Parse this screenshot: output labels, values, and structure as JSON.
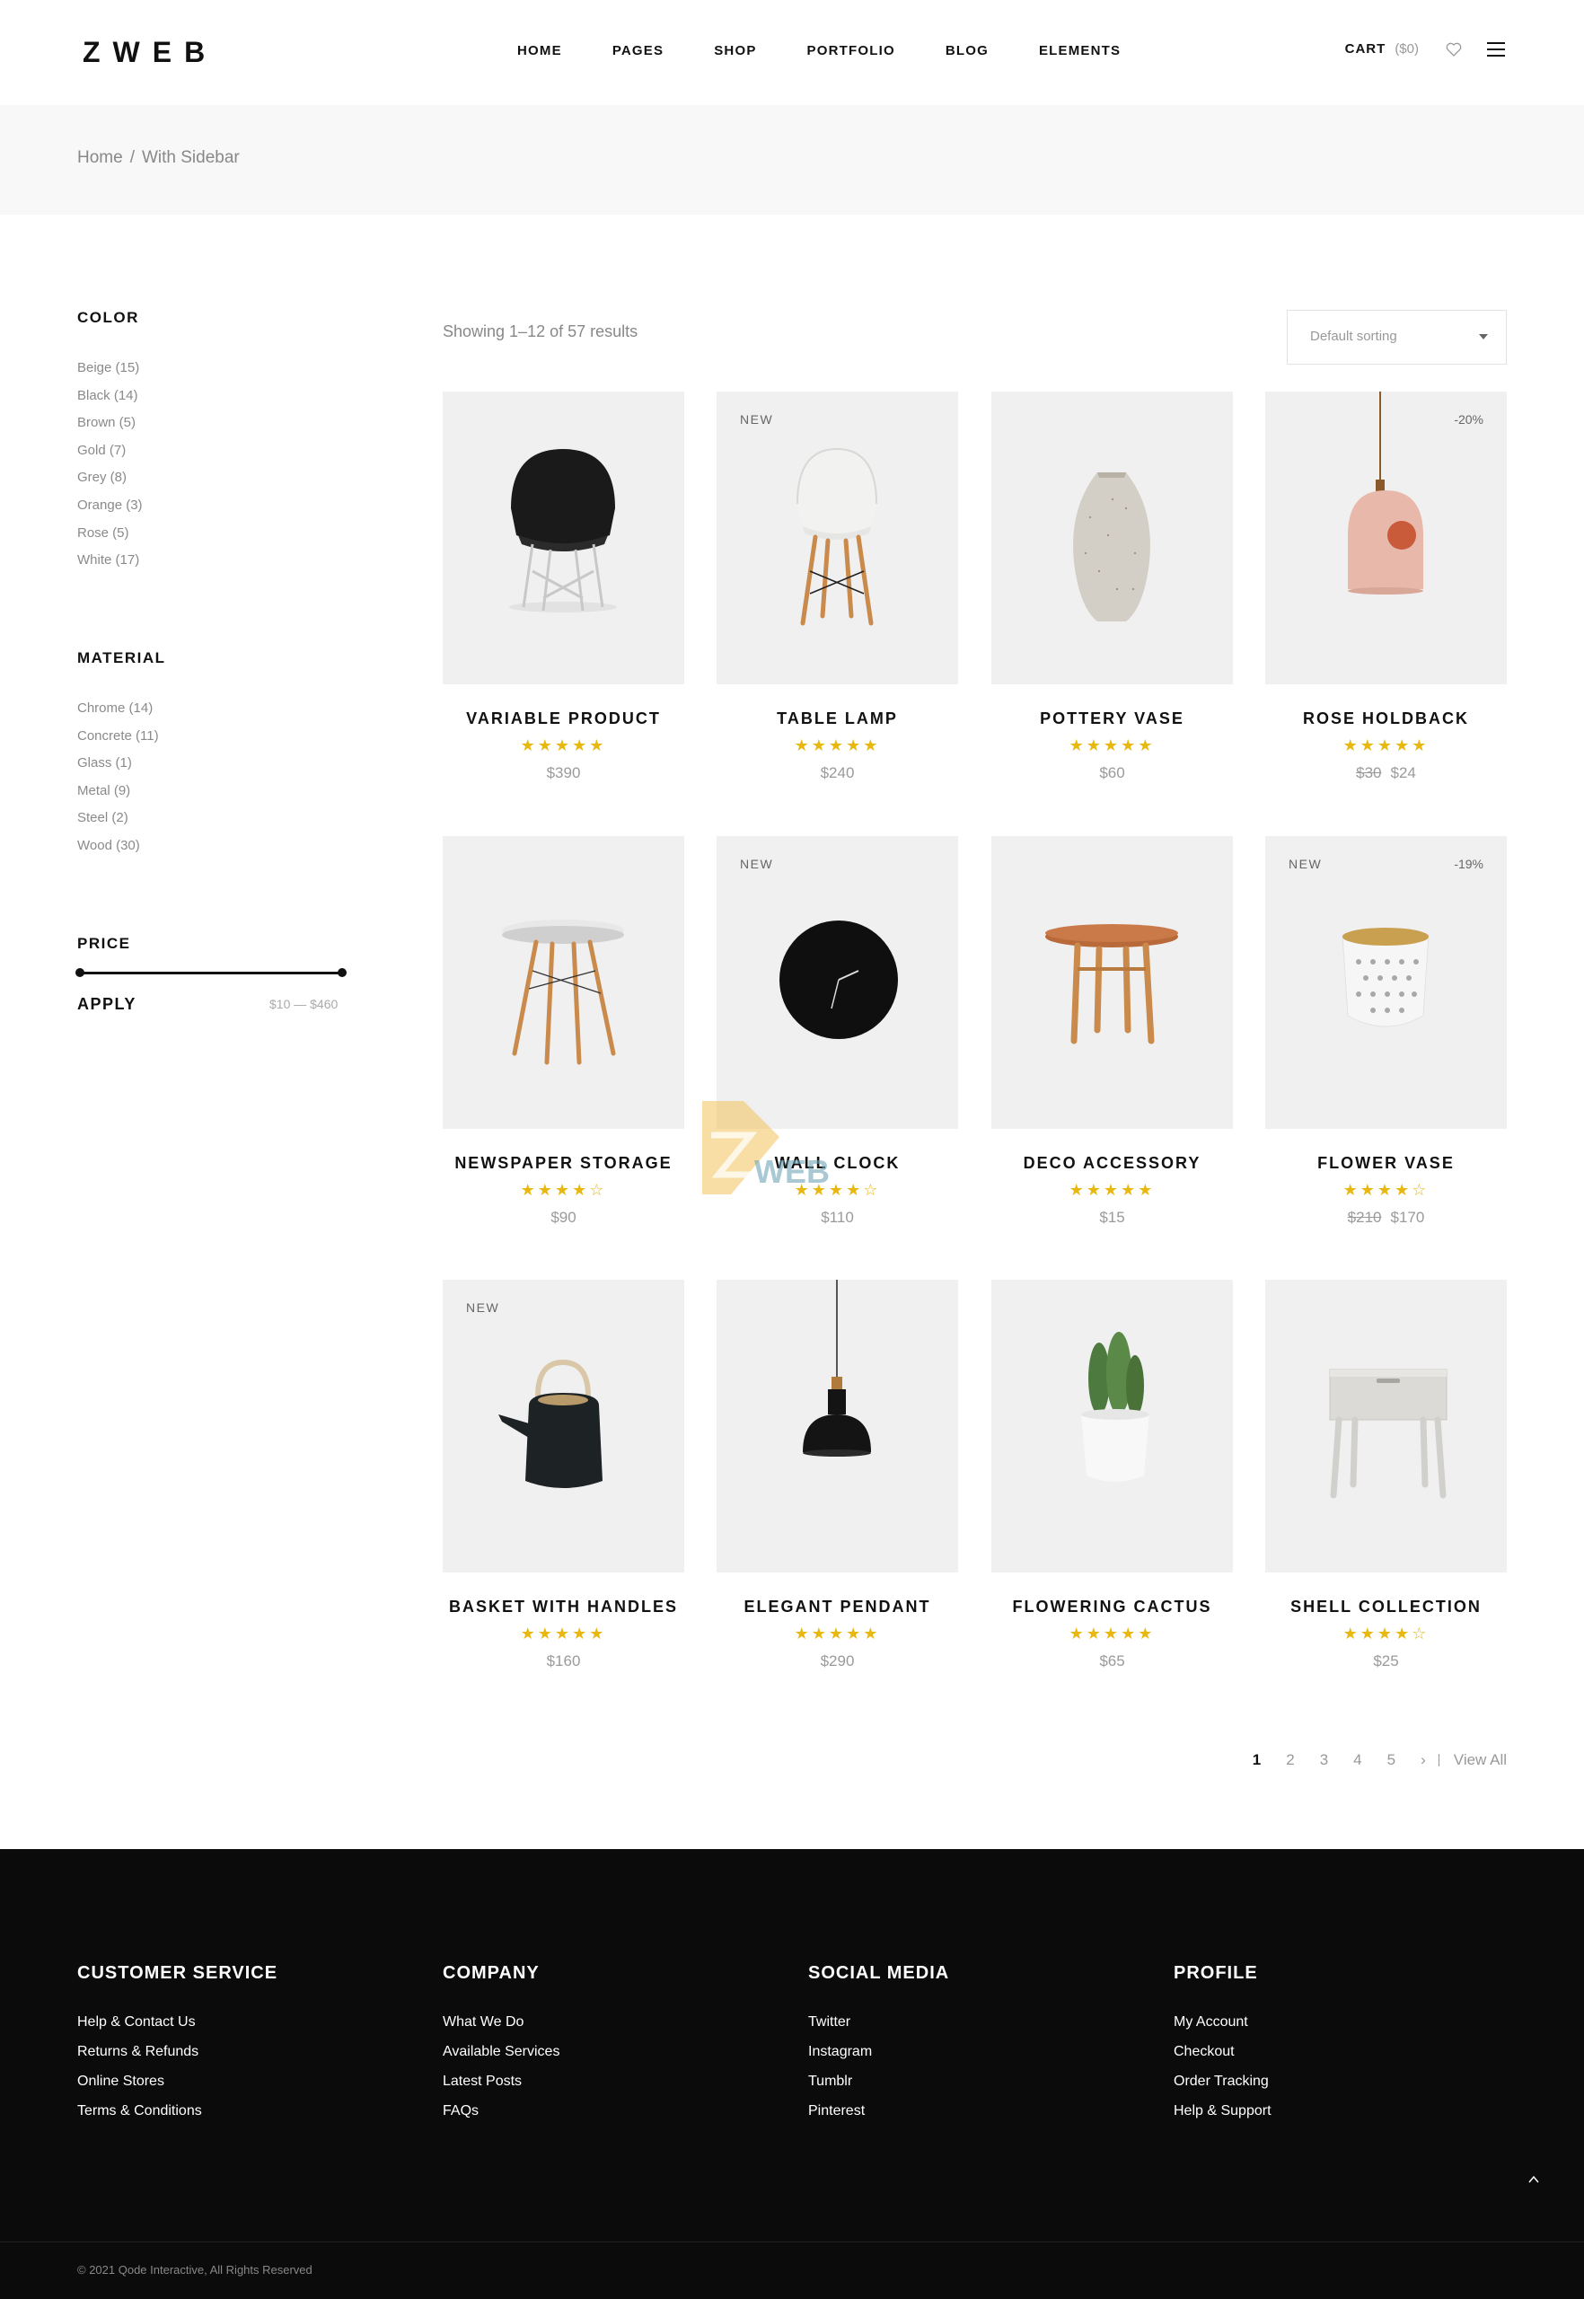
{
  "header": {
    "logo": "ZWEB",
    "nav": [
      "HOME",
      "PAGES",
      "SHOP",
      "PORTFOLIO",
      "BLOG",
      "ELEMENTS"
    ],
    "cart_label": "CART",
    "cart_total": "($0)"
  },
  "breadcrumb": {
    "home": "Home",
    "separator": "/",
    "current": "With Sidebar"
  },
  "sidebar": {
    "color_title": "COLOR",
    "colors": [
      "Beige (15)",
      "Black (14)",
      "Brown (5)",
      "Gold (7)",
      "Grey (8)",
      "Orange (3)",
      "Rose (5)",
      "White (17)"
    ],
    "material_title": "MATERIAL",
    "materials": [
      "Chrome (14)",
      "Concrete (11)",
      "Glass (1)",
      "Metal (9)",
      "Steel (2)",
      "Wood (30)"
    ],
    "price_title": "PRICE",
    "apply_label": "APPLY",
    "price_range": "$10 — $460"
  },
  "toolbar": {
    "results_text": "Showing 1–12 of 57 results",
    "sorting": "Default sorting"
  },
  "products": [
    {
      "name": "VARIABLE PRODUCT",
      "rating": 5,
      "price": "$390",
      "old_price": "",
      "badge_new": "",
      "badge_sale": ""
    },
    {
      "name": "TABLE LAMP",
      "rating": 5,
      "price": "$240",
      "old_price": "",
      "badge_new": "NEW",
      "badge_sale": ""
    },
    {
      "name": "POTTERY VASE",
      "rating": 5,
      "price": "$60",
      "old_price": "",
      "badge_new": "",
      "badge_sale": ""
    },
    {
      "name": "ROSE HOLDBACK",
      "rating": 5,
      "price": "$24",
      "old_price": "$30",
      "badge_new": "",
      "badge_sale": "-20%"
    },
    {
      "name": "NEWSPAPER STORAGE",
      "rating": 4,
      "price": "$90",
      "old_price": "",
      "badge_new": "",
      "badge_sale": ""
    },
    {
      "name": "WALL CLOCK",
      "rating": 4,
      "price": "$110",
      "old_price": "",
      "badge_new": "NEW",
      "badge_sale": ""
    },
    {
      "name": "DECO ACCESSORY",
      "rating": 5,
      "price": "$15",
      "old_price": "",
      "badge_new": "",
      "badge_sale": ""
    },
    {
      "name": "FLOWER VASE",
      "rating": 4,
      "price": "$170",
      "old_price": "$210",
      "badge_new": "NEW",
      "badge_sale": "-19%"
    },
    {
      "name": "BASKET WITH HANDLES",
      "rating": 5,
      "price": "$160",
      "old_price": "",
      "badge_new": "NEW",
      "badge_sale": ""
    },
    {
      "name": "ELEGANT PENDANT",
      "rating": 5,
      "price": "$290",
      "old_price": "",
      "badge_new": "",
      "badge_sale": ""
    },
    {
      "name": "FLOWERING CACTUS",
      "rating": 5,
      "price": "$65",
      "old_price": "",
      "badge_new": "",
      "badge_sale": ""
    },
    {
      "name": "SHELL COLLECTION",
      "rating": 4,
      "price": "$25",
      "old_price": "",
      "badge_new": "",
      "badge_sale": ""
    }
  ],
  "pagination": {
    "pages": [
      "1",
      "2",
      "3",
      "4",
      "5"
    ],
    "next": "›",
    "view_all": "View All"
  },
  "watermark": {
    "text": "WEB"
  },
  "footer": {
    "columns": [
      {
        "title": "CUSTOMER SERVICE",
        "links": [
          "Help & Contact Us",
          "Returns & Refunds",
          "Online Stores",
          "Terms & Conditions"
        ]
      },
      {
        "title": "COMPANY",
        "links": [
          "What We Do",
          "Available Services",
          "Latest Posts",
          "FAQs"
        ]
      },
      {
        "title": "SOCIAL MEDIA",
        "links": [
          "Twitter",
          "Instagram",
          "Tumblr",
          "Pinterest"
        ]
      },
      {
        "title": "PROFILE",
        "links": [
          "My Account",
          "Checkout",
          "Order Tracking",
          "Help & Support"
        ]
      }
    ],
    "copyright": "© 2021 Qode Interactive, All Rights Reserved"
  },
  "colors": {
    "star": "#e8b811",
    "footer_bg": "#0b0b0c",
    "image_bg": "#f0f0f0"
  }
}
